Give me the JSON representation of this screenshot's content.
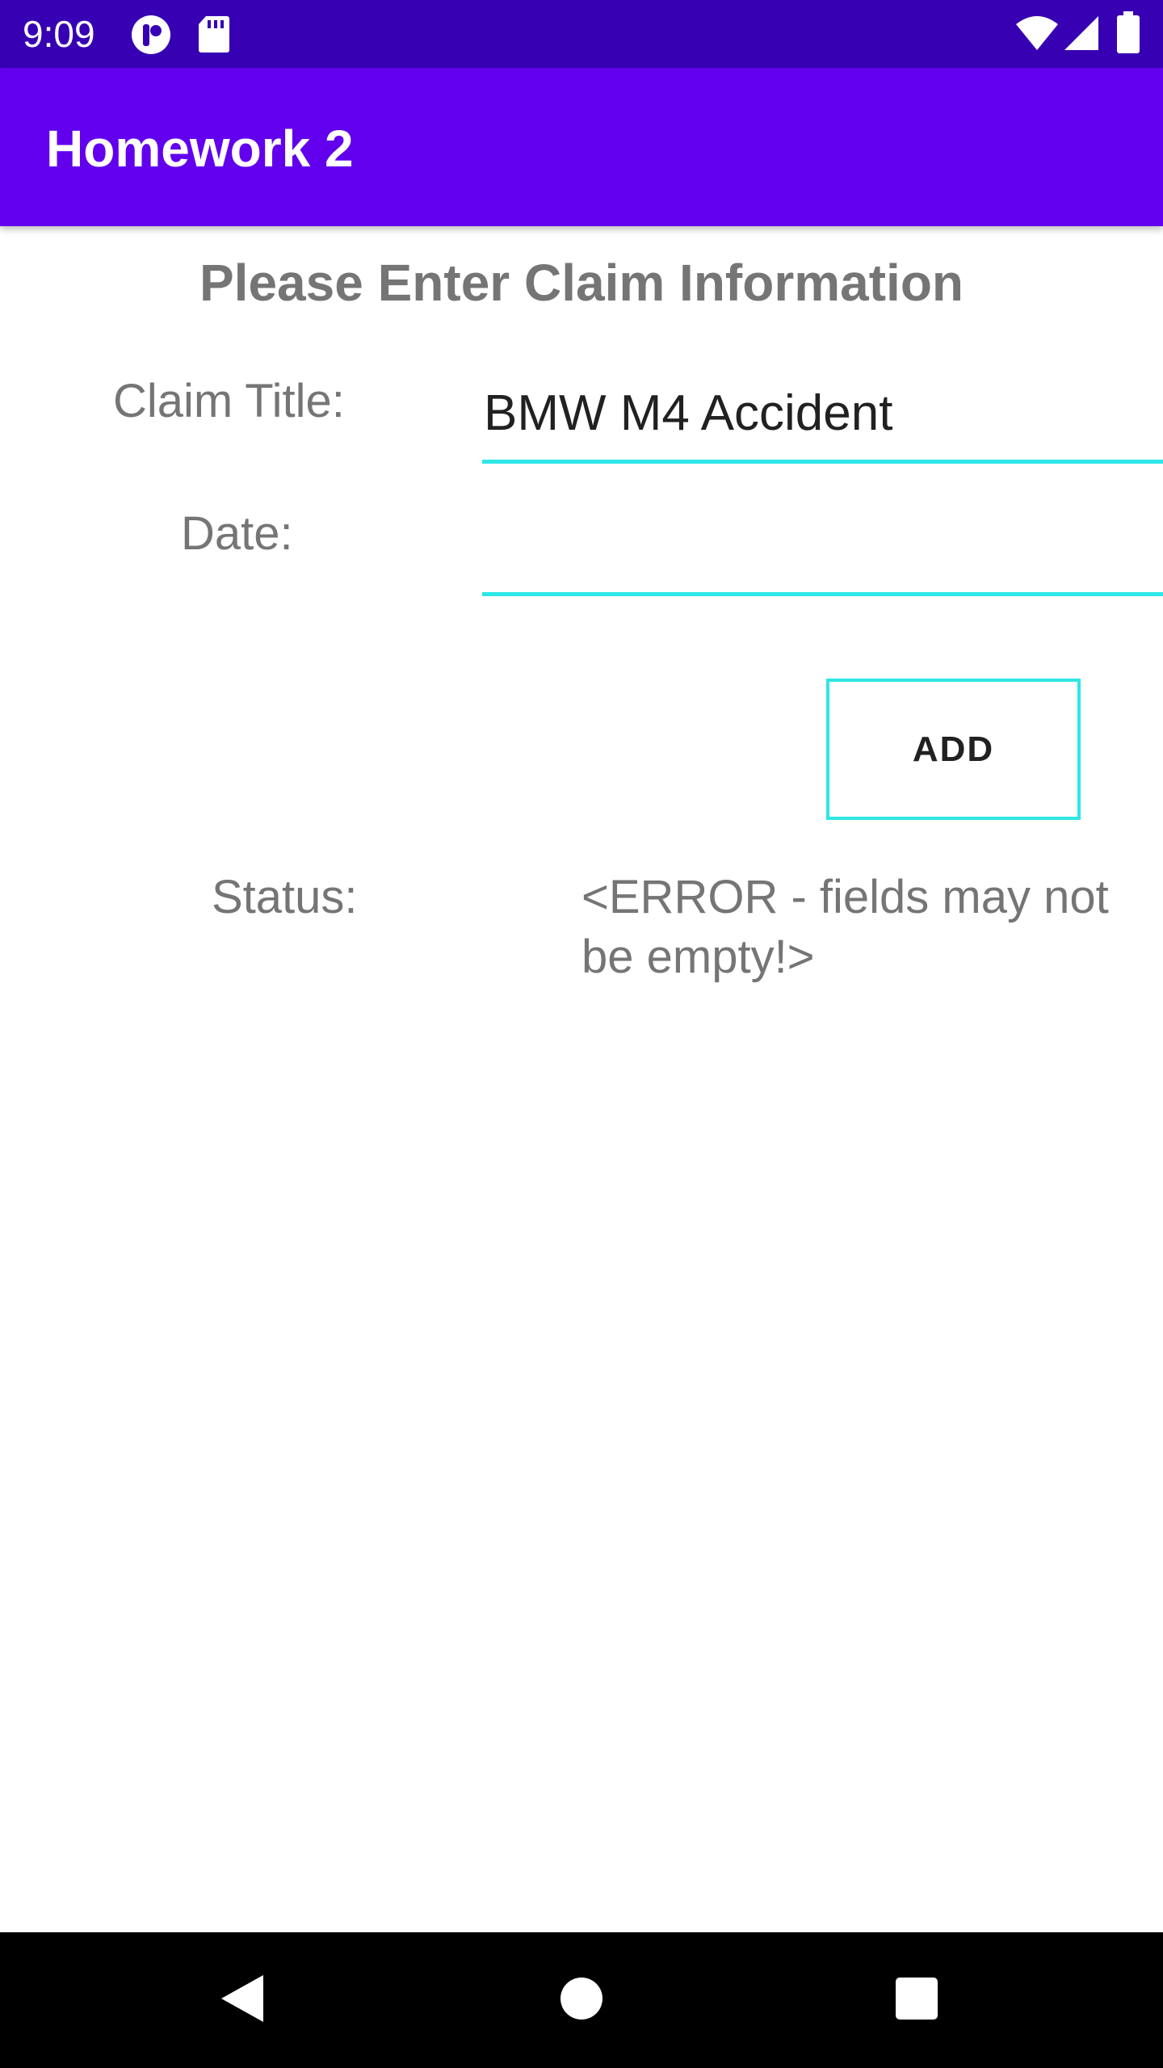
{
  "status_bar": {
    "time": "9:09",
    "icons": [
      "notification-app-icon",
      "sd-card-icon",
      "wifi-icon",
      "signal-icon",
      "battery-icon"
    ]
  },
  "app_bar": {
    "title": "Homework 2"
  },
  "form": {
    "heading": "Please Enter Claim Information",
    "claim_title_label": "Claim Title:",
    "claim_title_value": "BMW M4 Accident",
    "date_label": "Date:",
    "date_value": "",
    "add_label": "ADD",
    "status_label": "Status:",
    "status_message": "<ERROR - fields may not be empty!>"
  },
  "nav_bar": {
    "icons": [
      "back-icon",
      "home-icon",
      "recents-icon"
    ]
  },
  "colors": {
    "status_bar": "#3700B3",
    "app_bar": "#6200EE",
    "accent": "#2EE6E6",
    "label_text": "#757575"
  }
}
